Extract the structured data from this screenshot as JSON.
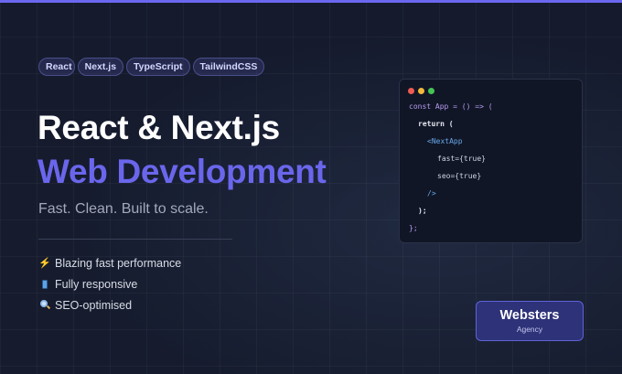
{
  "tags": [
    "React",
    "Next.js",
    "TypeScript",
    "TailwindCSS"
  ],
  "hero": {
    "title": "React & Next.js",
    "subtitle": "Web Development",
    "tagline": "Fast. Clean. Built to scale."
  },
  "features": [
    {
      "icon": "lightning-icon",
      "label": "Blazing fast performance"
    },
    {
      "icon": "mobile-phone-icon",
      "label": "Fully responsive"
    },
    {
      "icon": "magnifier-icon",
      "label": "SEO-optimised"
    }
  ],
  "code": {
    "line1": "const App = () => (",
    "line2": "return (",
    "line3": "<NextApp",
    "line4": "fast={true}",
    "line5": "seo={true}",
    "line6": "/>",
    "line7": ");",
    "line8": "};"
  },
  "brand": {
    "name": "Websters",
    "sub": "Agency"
  },
  "colors": {
    "accent": "#6b68f0",
    "background": "#141a2c",
    "subtitle": "#6a66ec",
    "brand_card": "#2e3278"
  }
}
